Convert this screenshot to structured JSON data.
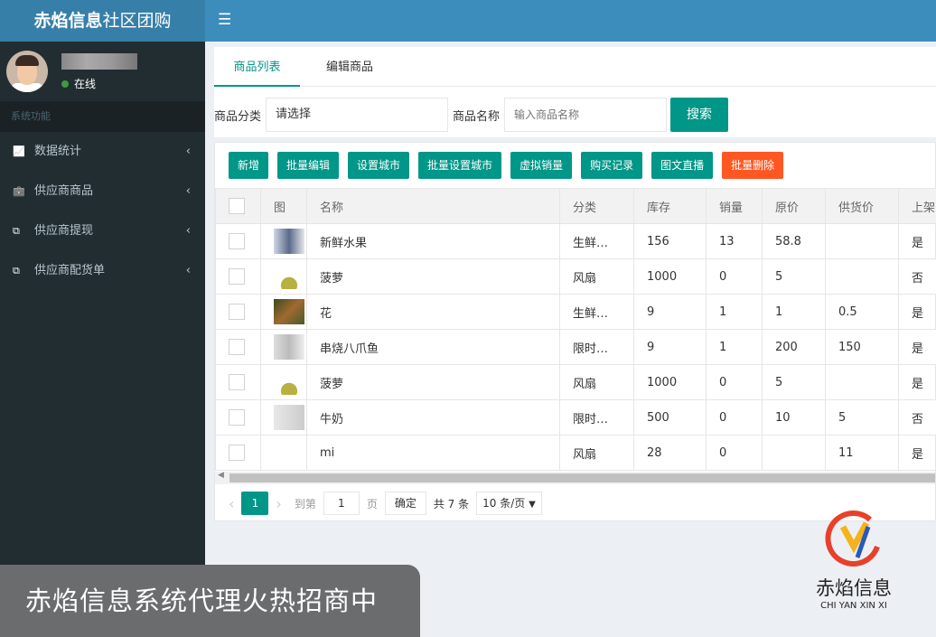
{
  "app": {
    "title_bold": "赤焰信息",
    "title_rest": "社区团购"
  },
  "user": {
    "status": "在线"
  },
  "sidebar": {
    "section": "系统功能",
    "items": [
      {
        "label": "数据统计",
        "icon": "chart-line-icon"
      },
      {
        "label": "供应商商品",
        "icon": "briefcase-icon"
      },
      {
        "label": "供应商提现",
        "icon": "share-icon"
      },
      {
        "label": "供应商配货单",
        "icon": "share-icon"
      }
    ]
  },
  "tabs": [
    "商品列表",
    "编辑商品"
  ],
  "search": {
    "category_label": "商品分类",
    "category_value": "请选择",
    "name_label": "商品名称",
    "name_placeholder": "输入商品名称",
    "button": "搜索"
  },
  "toolbar": [
    "新增",
    "批量编辑",
    "设置城市",
    "批量设置城市",
    "虚拟销量",
    "购买记录",
    "图文直播",
    "批量删除"
  ],
  "table": {
    "headers": [
      "图",
      "名称",
      "分类",
      "库存",
      "销量",
      "原价",
      "供货价",
      "上架"
    ],
    "rows": [
      [
        "新鲜水果",
        "生鲜…",
        "156",
        "13",
        "58.8",
        "",
        "是"
      ],
      [
        "菠萝",
        "风扇",
        "1000",
        "0",
        "5",
        "",
        "否"
      ],
      [
        "花",
        "生鲜…",
        "9",
        "1",
        "1",
        "0.5",
        "是"
      ],
      [
        "串烧八爪鱼",
        "限时…",
        "9",
        "1",
        "200",
        "150",
        "是"
      ],
      [
        "菠萝",
        "风扇",
        "1000",
        "0",
        "5",
        "",
        "是"
      ],
      [
        "牛奶",
        "限时…",
        "500",
        "0",
        "10",
        "5",
        "否"
      ],
      [
        "mi",
        "风扇",
        "28",
        "0",
        "",
        "11",
        "是"
      ]
    ]
  },
  "pager": {
    "current": "1",
    "goto_label": "到第",
    "goto_value": "1",
    "page_unit": "页",
    "confirm": "确定",
    "total": "共 7 条",
    "per_page": "10 条/页"
  },
  "colors": {
    "accent": "#009688",
    "danger": "#ff5722",
    "header": "#3c8dbc",
    "sidebar": "#222d32"
  },
  "caption": "赤焰信息系统代理火热招商中",
  "brand": {
    "name": "赤焰信息",
    "pinyin": "CHI YAN XIN XI"
  }
}
